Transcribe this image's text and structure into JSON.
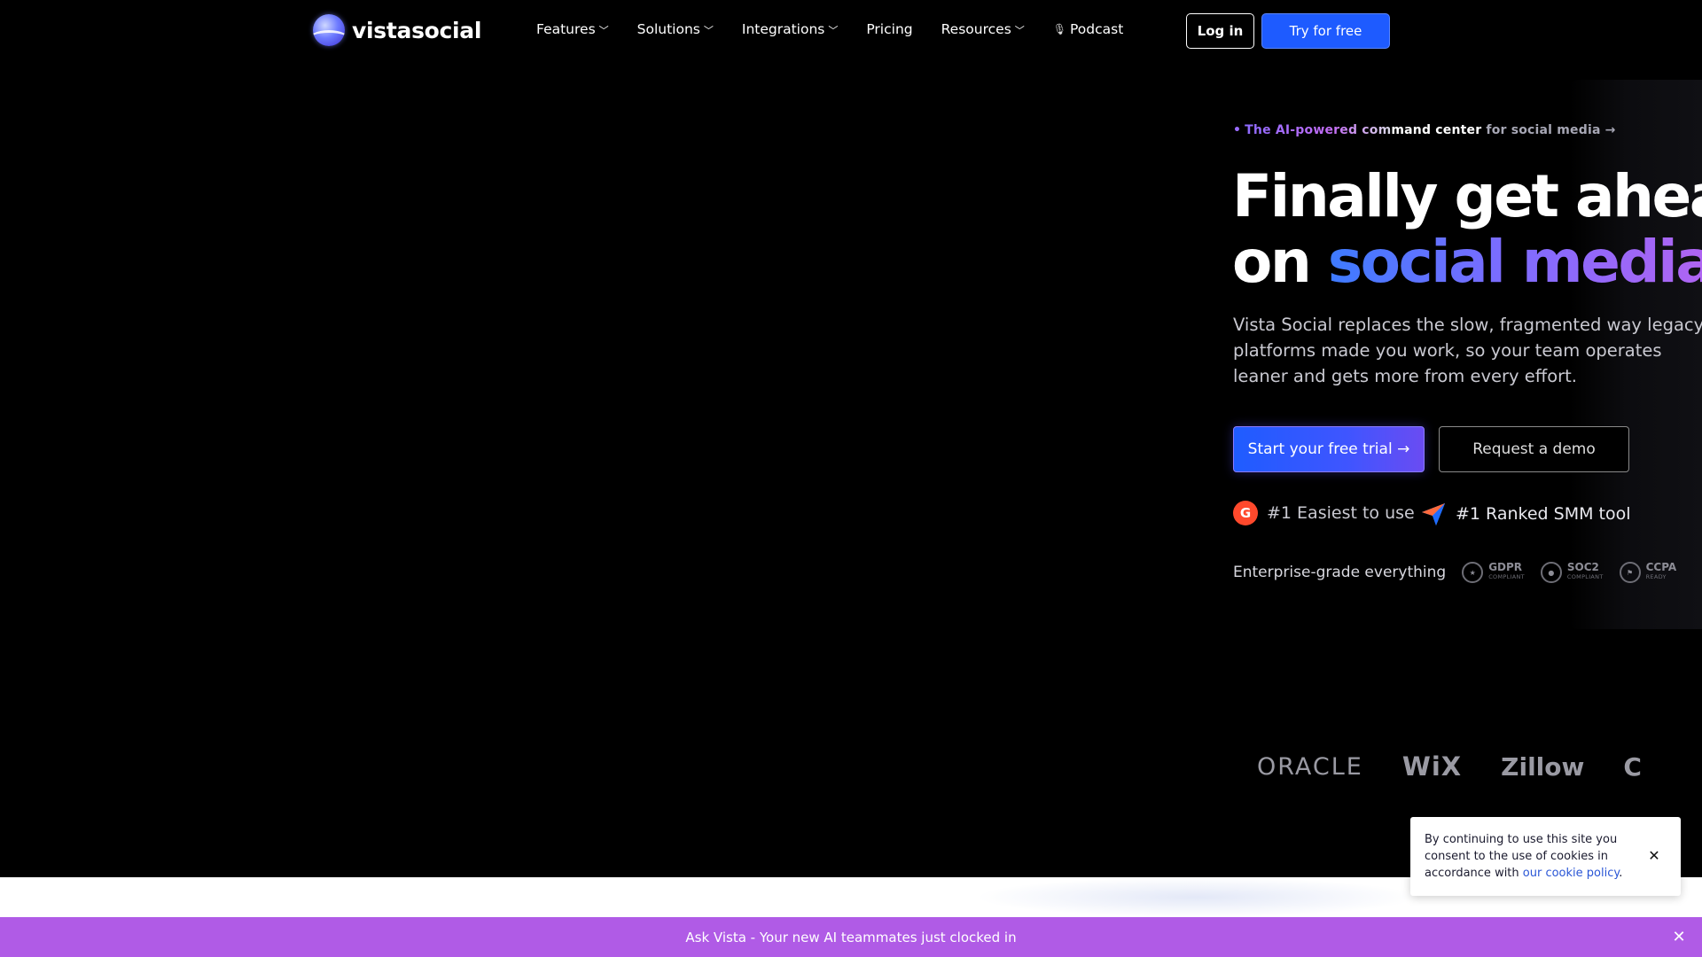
{
  "nav": {
    "logo_text": "vistasocial",
    "menu": [
      {
        "label": "Features",
        "has_dropdown": true
      },
      {
        "label": "Solutions",
        "has_dropdown": true
      },
      {
        "label": "Integrations",
        "has_dropdown": true
      },
      {
        "label": "Pricing",
        "has_dropdown": false
      },
      {
        "label": "Resources",
        "has_dropdown": true
      },
      {
        "label": "Podcast",
        "has_dropdown": false,
        "icon": "microphone-icon"
      }
    ],
    "login_label": "Log in",
    "try_label": "Try for free"
  },
  "hero": {
    "eyebrow_prefix": "The AI-powered com",
    "eyebrow_mid": "mand center",
    "eyebrow_tail": " for social media →",
    "headline_line1": "Finally get ahead",
    "headline_line2_plain": "on ",
    "headline_line2_accent": "social media",
    "subcopy": "Vista Social replaces the slow, fragmented way legacy platforms made you work, so your team operates leaner and gets more from every effort.",
    "primary_cta": "Start your free trial →",
    "secondary_cta": "Request a demo",
    "award_1": "#1 Easiest to use",
    "award_2": "#1 Ranked SMM tool",
    "enterprise_label": "Enterprise-grade everything",
    "badges": [
      {
        "title": "GDPR",
        "sub": "COMPLIANT"
      },
      {
        "title": "SOC2",
        "sub": "COMPLIANT"
      },
      {
        "title": "CCPA",
        "sub": "READY"
      }
    ]
  },
  "clients": [
    "ORACLE",
    "WiX",
    "Zillow",
    "C"
  ],
  "cookie": {
    "text": "By continuing to use this site you consent to the use of cookies in accordance with ",
    "link": "our cookie policy",
    "suffix": "."
  },
  "banner": {
    "text": "Ask Vista - Your new AI teammates just clocked in"
  },
  "colors": {
    "primary": "#1e5bff",
    "banner": "#b05be6",
    "accent_gradient_start": "#3d7bff",
    "accent_gradient_end": "#b264f2"
  }
}
